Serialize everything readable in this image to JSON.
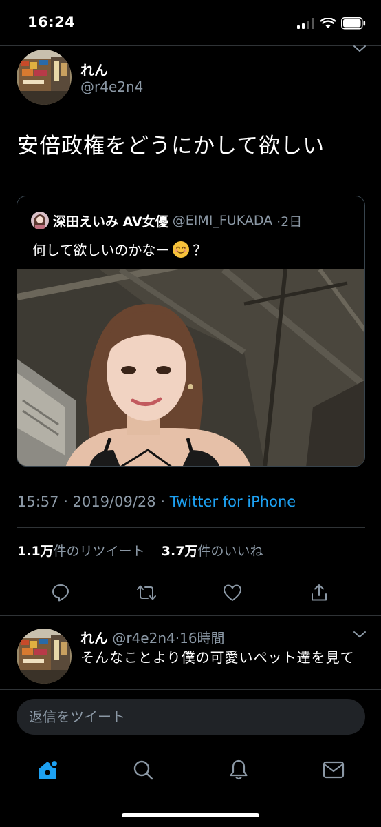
{
  "status_bar": {
    "time": "16:24"
  },
  "tweet": {
    "author_name": "れん",
    "author_handle": "@r4e2n4",
    "text": "安倍政権をどうにかして欲しい",
    "quoted": {
      "name": "深田えいみ AV女優",
      "handle": "@EIMI_FUKADA",
      "age": "·2日",
      "text": "何して欲しいのかなー",
      "text_tail": "？"
    },
    "time": "15:57",
    "date": "2019/09/28",
    "source": "Twitter for iPhone",
    "sep": "·",
    "retweets": "1.1万",
    "retweets_label": "件のリツイート",
    "likes": "3.7万",
    "likes_label": "件のいいね"
  },
  "reply": {
    "name": "れん",
    "handle": "@r4e2n4",
    "age": "·16時間",
    "text": "そんなことより僕の可愛いペット達を見て"
  },
  "compose": {
    "placeholder": "返信をツイート"
  },
  "icons": {
    "reply": "reply-icon",
    "retweet": "retweet-icon",
    "like": "heart-icon",
    "share": "share-icon",
    "home": "home-icon",
    "search": "search-icon",
    "notifications": "bell-icon",
    "messages": "mail-icon"
  },
  "colors": {
    "accent": "#1da1f2",
    "muted": "#8b98a5",
    "background": "#000000"
  }
}
